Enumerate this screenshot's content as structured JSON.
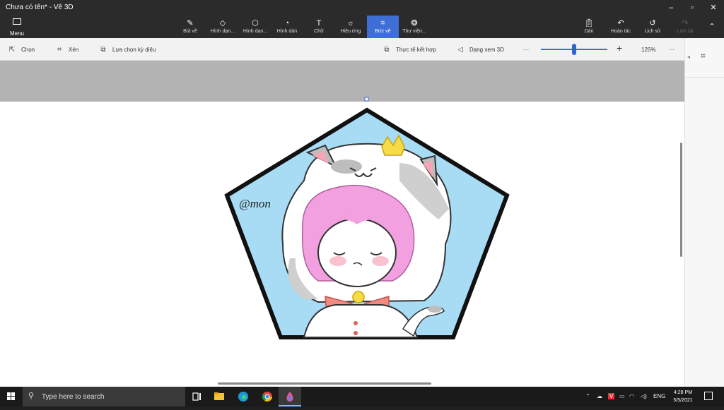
{
  "window": {
    "title": "Chưa có tên* - Vẽ 3D"
  },
  "ribbon": {
    "menu_label": "Menu",
    "tools": [
      {
        "label": "Bút vẽ",
        "icon": "brush-icon"
      },
      {
        "label": "Hình dạn...",
        "icon": "2d-shapes-icon"
      },
      {
        "label": "Hình dạn...",
        "icon": "3d-shapes-icon"
      },
      {
        "label": "Hình dán",
        "icon": "stickers-icon"
      },
      {
        "label": "Chữ",
        "icon": "text-icon"
      },
      {
        "label": "Hiệu ứng",
        "icon": "effects-icon"
      },
      {
        "label": "Bức vẽ",
        "icon": "canvas-icon",
        "active": true
      },
      {
        "label": "Thư viện...",
        "icon": "3d-library-icon"
      }
    ],
    "right_tools": [
      {
        "label": "Dán",
        "icon": "paste-icon"
      },
      {
        "label": "Hoàn tác",
        "icon": "undo-icon"
      },
      {
        "label": "Lịch sử",
        "icon": "history-icon"
      },
      {
        "label": "Làm lại",
        "icon": "redo-icon",
        "disabled": true
      }
    ]
  },
  "toolbar": {
    "select": "Chọn",
    "crop": "Xén",
    "magic_select": "Lựa chọn kỳ diệu",
    "mixed_reality": "Thực tế kết hợp",
    "view_3d": "Dạng xem 3D",
    "zoom_minus": "—",
    "zoom_plus": "+",
    "zoom_level": "125%",
    "more": "···",
    "zoom_fraction": 0.5
  },
  "artwork": {
    "signature": "@mon"
  },
  "taskbar": {
    "search_placeholder": "Type here to search",
    "lang": "ENG",
    "time": "4:28 PM",
    "date": "5/5/2021"
  },
  "colors": {
    "accent": "#3d6fd6",
    "ribbon_bg": "#2b2b2b",
    "pentagon_fill": "#a8dcf5",
    "hair": "#f2a0e0",
    "crown": "#f7dc4a",
    "bow": "#f28a82"
  }
}
